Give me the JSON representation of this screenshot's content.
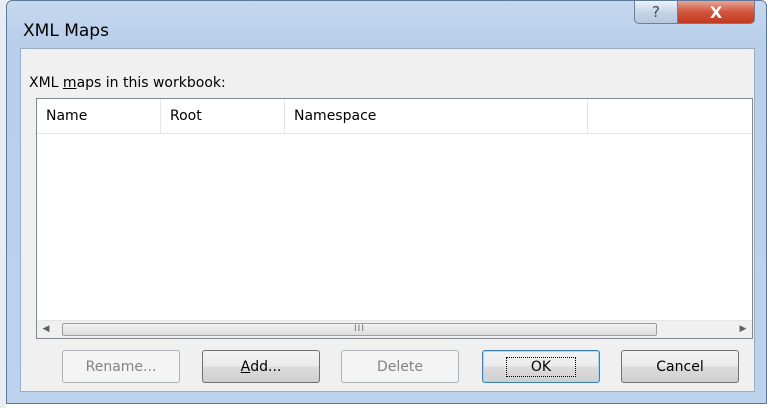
{
  "window": {
    "title": "XML Maps",
    "help_glyph": "?",
    "close_glyph": "X"
  },
  "maps_list": {
    "label_pre": "XML ",
    "label_accel": "m",
    "label_post": "aps in this workbook:",
    "columns": [
      "Name",
      "Root",
      "Namespace"
    ],
    "rows": []
  },
  "scrollbar": {
    "left_arrow": "◀",
    "right_arrow": "▶",
    "grip": "III"
  },
  "buttons": {
    "rename": "Rename...",
    "add_accel": "A",
    "add_rest": "dd...",
    "delete": "Delete",
    "ok": "OK",
    "cancel": "Cancel"
  }
}
